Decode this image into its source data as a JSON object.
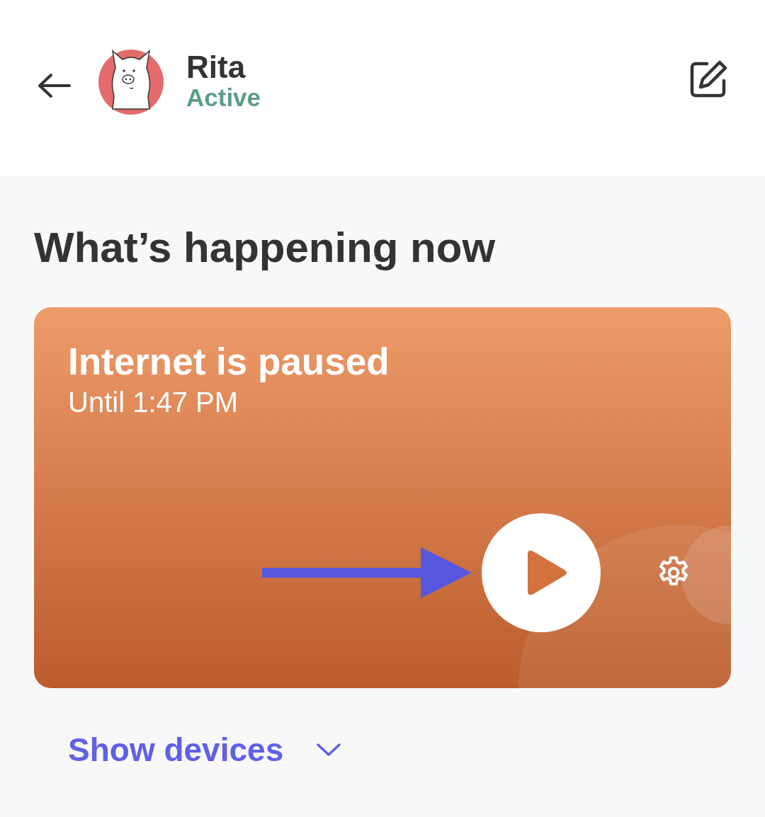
{
  "header": {
    "name": "Rita",
    "status": "Active"
  },
  "section": {
    "title": "What’s happening now"
  },
  "card": {
    "title": "Internet is paused",
    "subtitle": "Until 1:47 PM"
  },
  "devices_toggle": {
    "label": "Show devices",
    "expanded": false
  }
}
